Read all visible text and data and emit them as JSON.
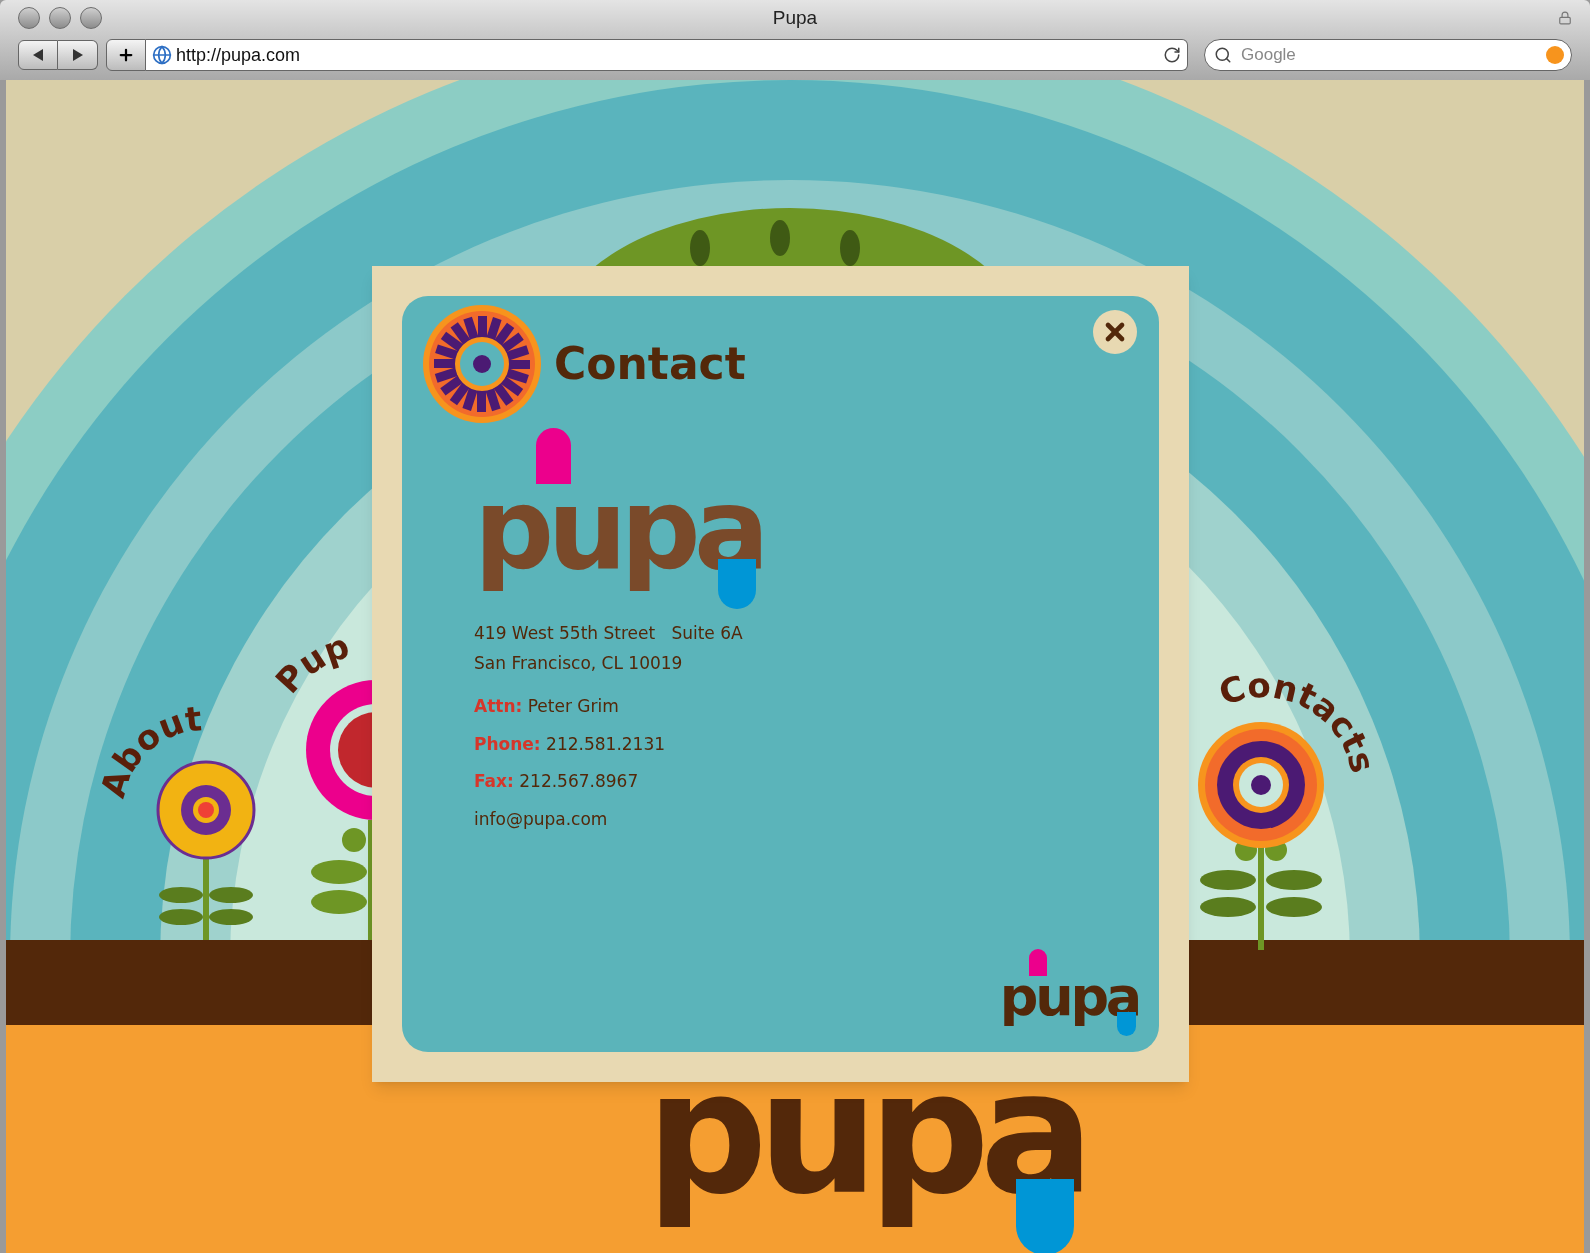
{
  "window": {
    "title": "Pupa"
  },
  "toolbar": {
    "url": "http://pupa.com",
    "search": {
      "placeholder": "Google"
    }
  },
  "page": {
    "nav": [
      {
        "label": "About"
      },
      {
        "label": "Pup"
      },
      {
        "label": "Contacts"
      }
    ],
    "footer_logo": "pupa"
  },
  "dialog": {
    "title": "Contact",
    "logo": "pupa",
    "address": [
      "419 West 55th Street   Suite 6A",
      "San Francisco, CL 10019"
    ],
    "details": [
      {
        "label": "Attn:",
        "value": "Peter Grim"
      },
      {
        "label": "Phone:",
        "value": "212.581.2131"
      },
      {
        "label": "Fax:",
        "value": "212.567.8967"
      }
    ],
    "email": "info@pupa.com",
    "corner_logo": "pupa"
  }
}
